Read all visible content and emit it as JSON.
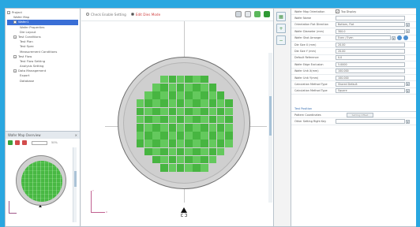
{
  "tree": {
    "items": [
      {
        "label": "Project",
        "level": 0,
        "selected": false
      },
      {
        "label": "Wafer Map",
        "level": 1,
        "selected": false
      },
      {
        "label": "Wafer1",
        "level": 1,
        "selected": true
      },
      {
        "label": "Wafer Properties",
        "level": 2,
        "selected": false
      },
      {
        "label": "Die Layout",
        "level": 2,
        "selected": false
      },
      {
        "label": "Test Conditions",
        "level": 1,
        "selected": false
      },
      {
        "label": "Test Plan",
        "level": 2,
        "selected": false
      },
      {
        "label": "Test Spec",
        "level": 2,
        "selected": false
      },
      {
        "label": "Measurement Conditions",
        "level": 2,
        "selected": false
      },
      {
        "label": "Test Flow",
        "level": 1,
        "selected": false
      },
      {
        "label": "Test Flow Setting",
        "level": 2,
        "selected": false
      },
      {
        "label": "Analysis Setting",
        "level": 2,
        "selected": false
      },
      {
        "label": "Data Management",
        "level": 1,
        "selected": false
      },
      {
        "label": "Export",
        "level": 2,
        "selected": false
      },
      {
        "label": "Database",
        "level": 2,
        "selected": false
      }
    ]
  },
  "mini_panel": {
    "title": "Wafer Map Overview",
    "close": "×",
    "zoom_pct": "50%"
  },
  "center": {
    "radio_all": "Check Enable Setting",
    "radio_edit": "Edit Dies Mode",
    "axis_x": "X",
    "axis_y": "Y"
  },
  "props": {
    "rows": [
      {
        "label": "Wafer Map Orientation",
        "value": "Top Display",
        "kind": "check"
      },
      {
        "label": "Wafer Name",
        "value": "",
        "kind": "text"
      },
      {
        "label": "Orientation Flat Direction",
        "value": "Bottom, Flat",
        "kind": "select"
      },
      {
        "label": "Wafer Diameter (mm)",
        "value": "300.0",
        "kind": "select"
      },
      {
        "label": "Wafer Shot Arrange",
        "value": "Even / Even",
        "kind": "select-icons"
      },
      {
        "label": "Die Size X (mm)",
        "value": "20.00",
        "kind": "text"
      },
      {
        "label": "Die Size Y (mm)",
        "value": "20.00",
        "kind": "text"
      },
      {
        "label": "Default Reference",
        "value": "0.0",
        "kind": "text"
      },
      {
        "label": "Wafer Edge Exclusion",
        "value": "5.0000",
        "kind": "text"
      },
      {
        "label": "Wafer Unit X(mm)",
        "value": "100.000",
        "kind": "text"
      },
      {
        "label": "Wafer Unit Y(mm)",
        "value": "100.000",
        "kind": "text"
      },
      {
        "label": "Calculation Method Type",
        "value": "Shared Default",
        "kind": "select"
      },
      {
        "label": "Calculation Method Type",
        "value": "Square",
        "kind": "select"
      }
    ],
    "section": "Test Position",
    "section_rows": [
      {
        "label": "Pattern Coordinates",
        "button": "Setting Offset"
      },
      {
        "label": "Other Setting Right Key",
        "value": "",
        "kind": "select"
      }
    ]
  },
  "colors": {
    "die_dark": "#47b541",
    "die_light": "#64c95d",
    "wafer_fill": "#d4d4d4",
    "selection": "#3a6fd6",
    "background": "#2aa7e0"
  }
}
